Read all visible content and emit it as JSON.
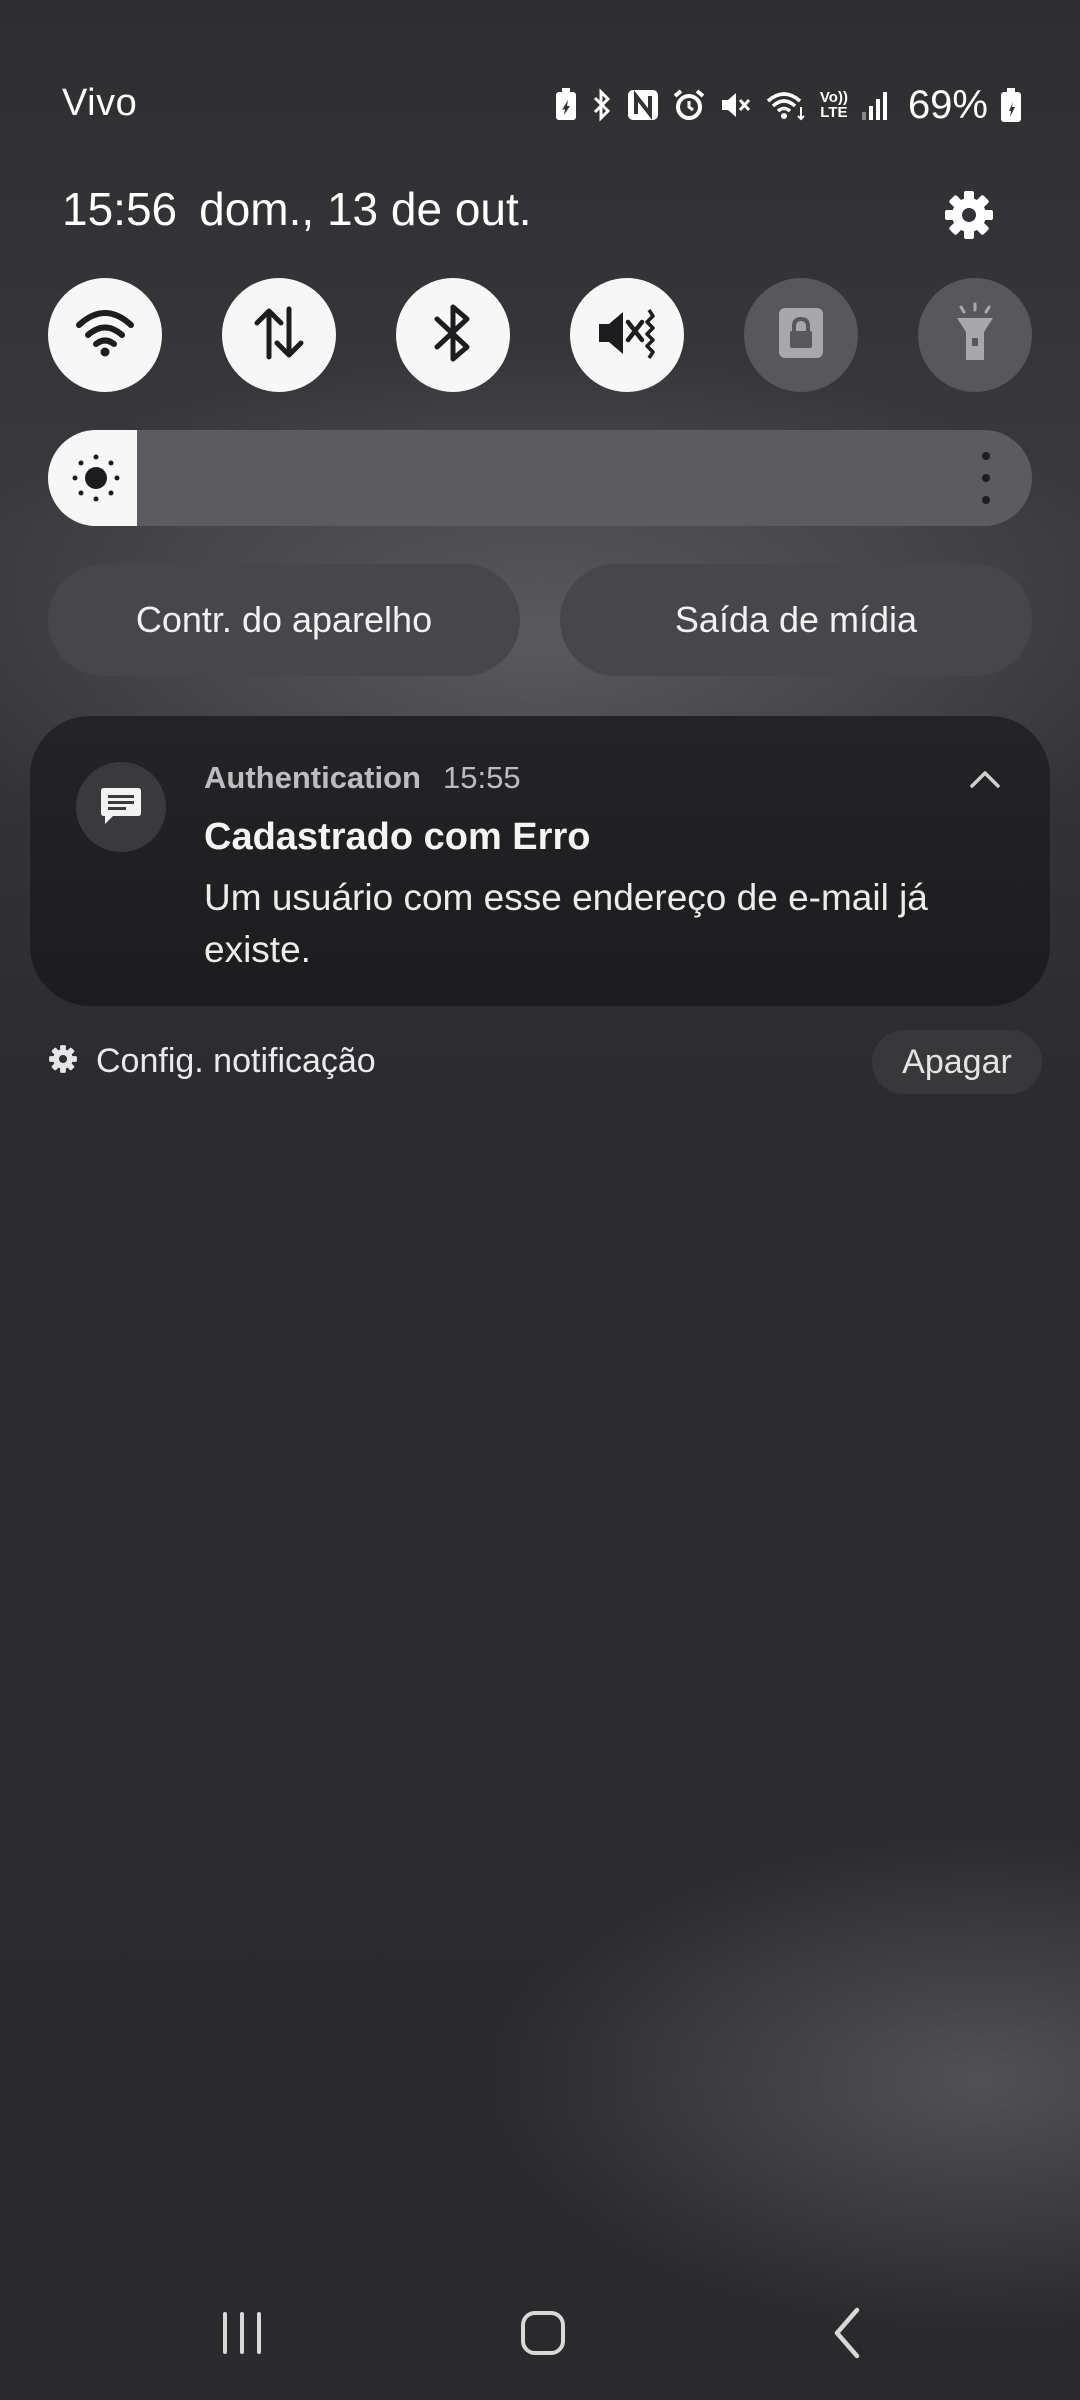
{
  "status_bar": {
    "carrier": "Vivo",
    "battery_percent": "69%",
    "icons": [
      "battery-saver-icon",
      "bluetooth-icon",
      "nfc-icon",
      "alarm-icon",
      "mute-icon",
      "wifi-icon",
      "volte-icon",
      "signal-icon",
      "battery-icon"
    ],
    "volte_label_top": "Vo))",
    "volte_label_bottom": "LTE"
  },
  "header": {
    "time": "15:56",
    "date": "dom., 13 de out."
  },
  "quick_toggles": [
    {
      "name": "wifi",
      "icon": "wifi-icon",
      "state": "on"
    },
    {
      "name": "mobile-data",
      "icon": "data-arrows-icon",
      "state": "on"
    },
    {
      "name": "bluetooth",
      "icon": "bluetooth-icon",
      "state": "on"
    },
    {
      "name": "sound",
      "icon": "mute-vibrate-icon",
      "state": "on"
    },
    {
      "name": "rotation-lock",
      "icon": "lock-icon",
      "state": "off"
    },
    {
      "name": "flashlight",
      "icon": "flashlight-icon",
      "state": "off"
    }
  ],
  "brightness": {
    "level_fraction": 0.09
  },
  "buttons": {
    "device_control": "Contr. do aparelho",
    "media_output": "Saída de mídia"
  },
  "notification": {
    "app": "Authentication",
    "time": "15:55",
    "title": "Cadastrado com Erro",
    "body": "Um usuário com esse endereço de e-mail já existe."
  },
  "footer": {
    "settings_label": "Config. notificação",
    "clear_label": "Apagar"
  },
  "colors": {
    "toggle_on": "#f7f7f7",
    "toggle_off": "#58575b",
    "card": "#1c1c1e"
  }
}
